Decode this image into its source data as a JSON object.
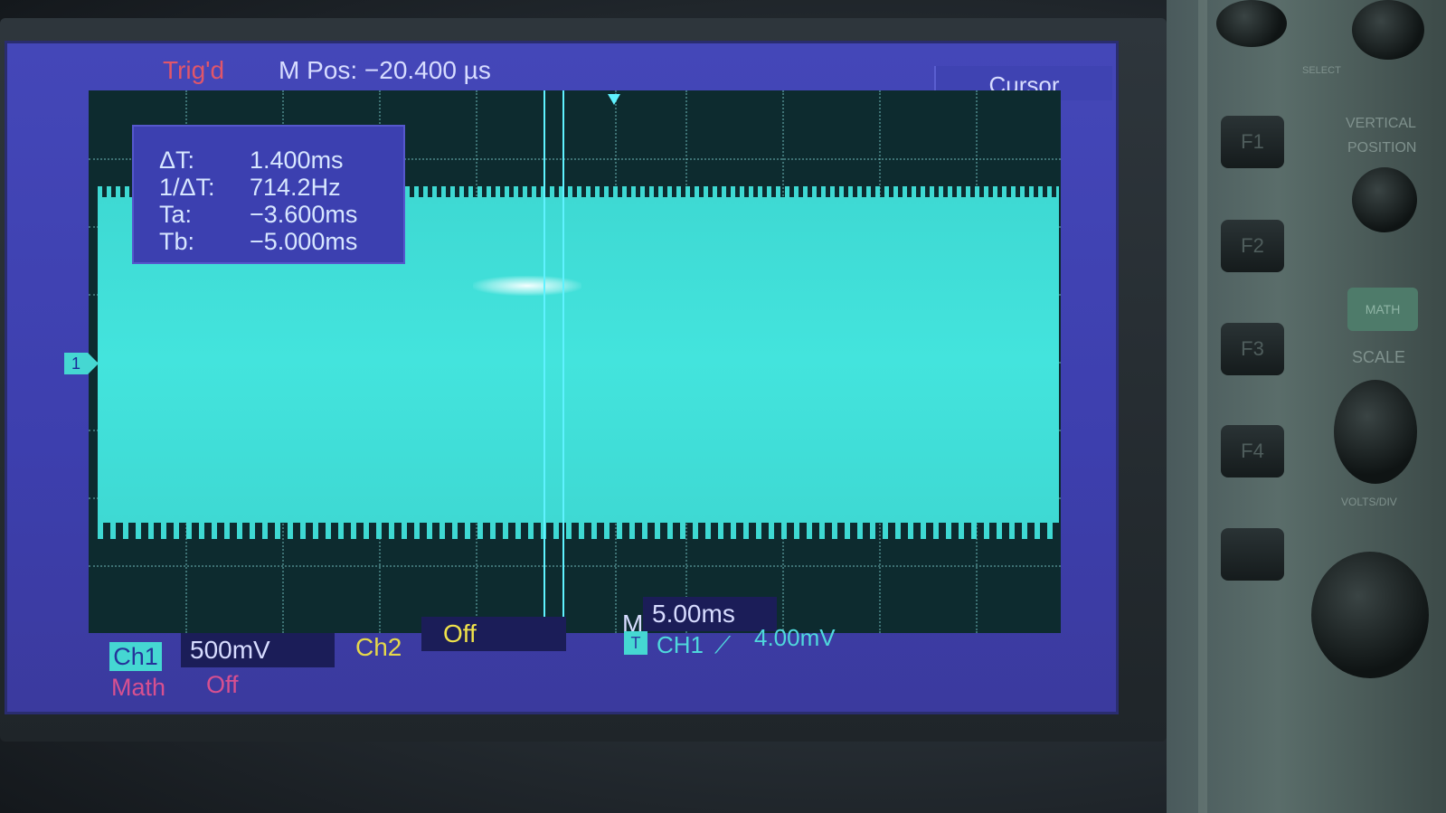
{
  "header": {
    "trigger_status": "Trig'd",
    "main_position": "M Pos: −20.400 µs",
    "menu_title": "Cursor"
  },
  "cursor_readout": {
    "delta_t_label": "ΔT:",
    "delta_t_value": "1.400ms",
    "freq_label": "1/ΔT:",
    "freq_value": "714.2Hz",
    "ta_label": "Ta:",
    "ta_value": "−3.600ms",
    "tb_label": "Tb:",
    "tb_value": "−5.000ms"
  },
  "channel_marker": "1",
  "status_bar": {
    "ch1_label": "Ch1",
    "ch1_scale": "500mV",
    "ch2_label": "Ch2",
    "ch2_scale": "Off",
    "timebase_label": "M",
    "timebase_value": "5.00ms",
    "trigger_icon": "T",
    "trigger_source": "CH1",
    "trigger_edge": "⟋",
    "trigger_level": "4.00mV",
    "math_label": "Math",
    "math_value": "Off"
  },
  "panel": {
    "f1": "F1",
    "f2": "F2",
    "f3": "F3",
    "f4": "F4",
    "vertical_label": "VERTICAL",
    "position_label": "POSITION",
    "math_button": "MATH",
    "scale_label": "SCALE",
    "volts_div": "VOLTS/DIV",
    "select_label": "SELECT"
  },
  "colors": {
    "trace": "#3ed9d3",
    "trig_status": "#e0566a",
    "ch2": "#f0e24a",
    "math": "#d75090",
    "screen_bg": "#4447b8"
  }
}
